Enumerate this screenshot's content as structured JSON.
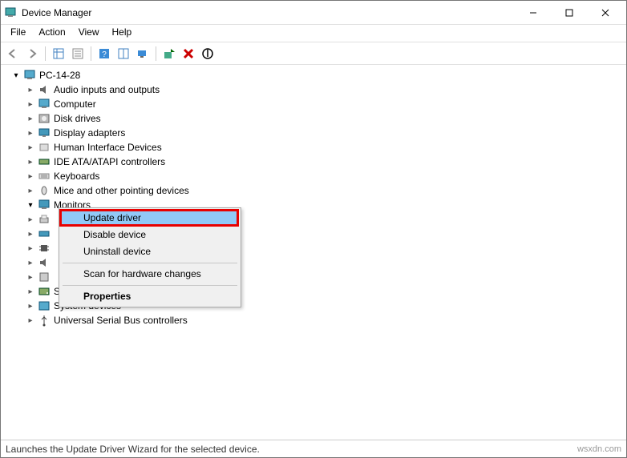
{
  "title": "Device Manager",
  "menu": [
    "File",
    "Action",
    "View",
    "Help"
  ],
  "root": "PC-14-28",
  "categories": [
    {
      "label": "Audio inputs and outputs",
      "icon": "audio"
    },
    {
      "label": "Computer",
      "icon": "computer"
    },
    {
      "label": "Disk drives",
      "icon": "disk"
    },
    {
      "label": "Display adapters",
      "icon": "display"
    },
    {
      "label": "Human Interface Devices",
      "icon": "hid"
    },
    {
      "label": "IDE ATA/ATAPI controllers",
      "icon": "ide"
    },
    {
      "label": "Keyboards",
      "icon": "keyboard"
    },
    {
      "label": "Mice and other pointing devices",
      "icon": "mouse"
    },
    {
      "label": "Monitors",
      "icon": "monitor",
      "expanded": true
    }
  ],
  "categories_after": [
    {
      "label": "Storage controllers",
      "icon": "storage"
    },
    {
      "label": "System devices",
      "icon": "system"
    },
    {
      "label": "Universal Serial Bus controllers",
      "icon": "usb"
    }
  ],
  "obscured_placeholder_icons": [
    "printq",
    "portd",
    "proc",
    "sound",
    "swdev"
  ],
  "context_menu": {
    "items": [
      {
        "label": "Update driver",
        "selected": true
      },
      {
        "label": "Disable device"
      },
      {
        "label": "Uninstall device"
      }
    ],
    "scan": "Scan for hardware changes",
    "properties": "Properties"
  },
  "statusbar": "Launches the Update Driver Wizard for the selected device.",
  "watermark": "wsxdn.com"
}
